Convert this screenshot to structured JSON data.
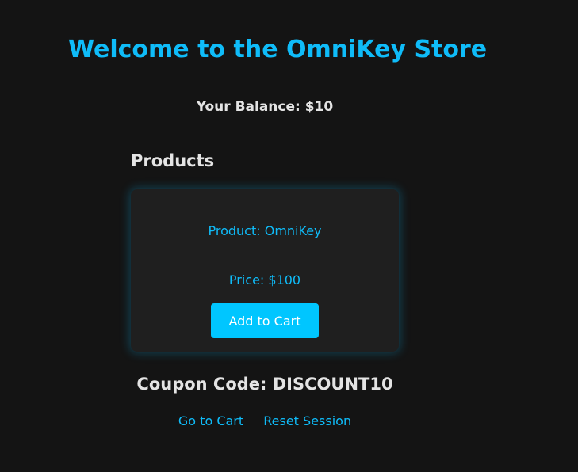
{
  "header": {
    "title": "Welcome to the OmniKey Store"
  },
  "balance": {
    "text": "Your Balance: $10"
  },
  "products": {
    "heading": "Products",
    "items": [
      {
        "name_text": "Product: OmniKey",
        "price_text": "Price: $100",
        "button_label": "Add to Cart"
      }
    ]
  },
  "coupon": {
    "text": "Coupon Code: DISCOUNT10"
  },
  "footer_links": {
    "cart_label": "Go to Cart",
    "reset_label": "Reset Session"
  },
  "colors": {
    "background": "#141414",
    "accent": "#0fbcf9",
    "button": "#00c6ff",
    "card": "#1f1f1f",
    "text": "#e4e4e4"
  }
}
